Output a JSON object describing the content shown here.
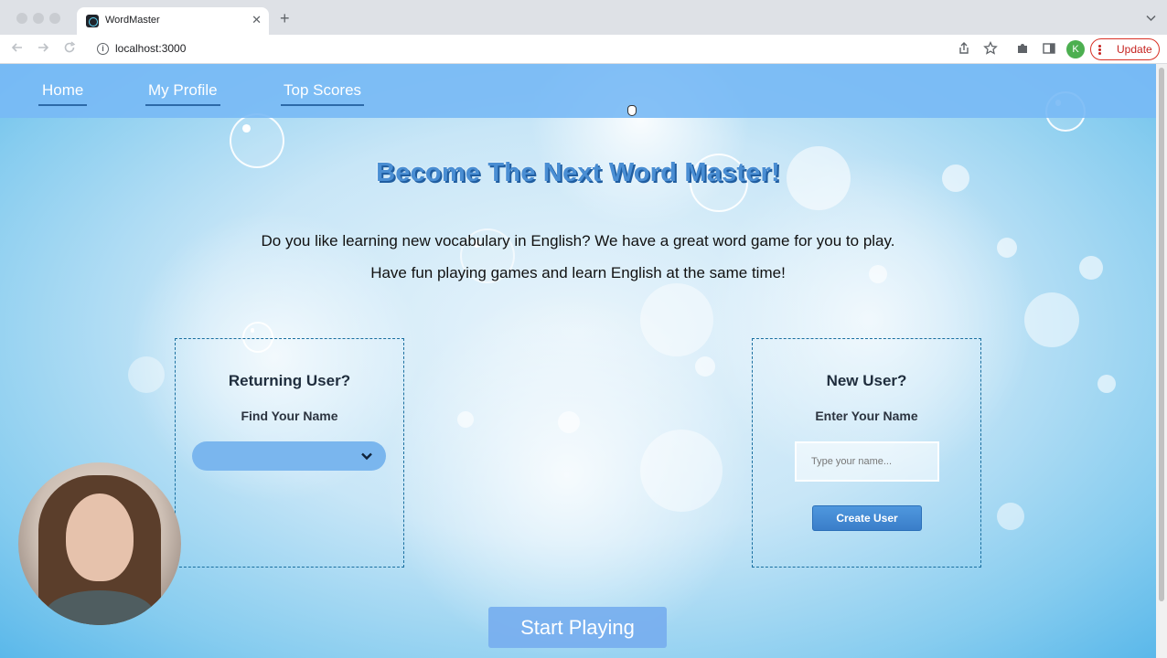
{
  "browser": {
    "tab_title": "WordMaster",
    "tab_close": "✕",
    "new_tab": "+",
    "url": "localhost:3000",
    "profile_initial": "K",
    "update_label": "Update"
  },
  "nav": {
    "links": [
      "Home",
      "My Profile",
      "Top Scores"
    ]
  },
  "hero": {
    "title": "Become The Next Word Master!",
    "line1": "Do you like learning new vocabulary in English? We have a great word game for you to play.",
    "line2": "Have fun playing games and learn English at the same time!"
  },
  "returning": {
    "title": "Returning User?",
    "subtitle": "Find Your Name",
    "selected_value": ""
  },
  "new_user": {
    "title": "New User?",
    "subtitle": "Enter Your Name",
    "placeholder": "Type your name...",
    "button": "Create User"
  },
  "start_button": "Start Playing",
  "colors": {
    "navbar": "#78b9f5",
    "title_blue": "#4a8ed3",
    "button_blue": "#3a7ec9",
    "update_red": "#d93025"
  }
}
